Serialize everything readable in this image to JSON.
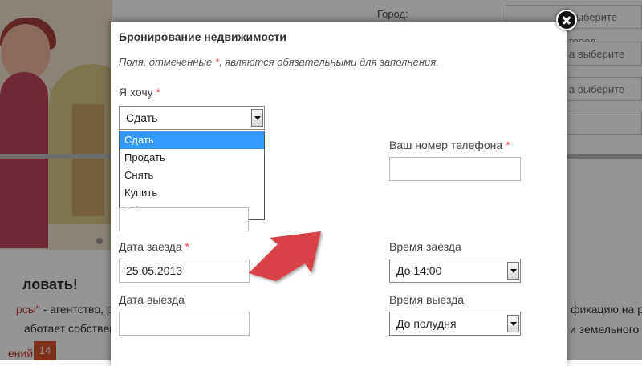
{
  "background": {
    "city_label": "Город:",
    "fields": [
      "Выберите город",
      "а выберите",
      "а выберите",
      ""
    ],
    "welcome": "ловать!",
    "text_line1_highlight": "рсы\"",
    "text_line1_rest": " - агентство, рабо",
    "text_line2": "аботает собственный",
    "reviews_label": "ений",
    "reviews_count": "14",
    "right_text1": "фикацию на ра",
    "right_text2": "и земельного п"
  },
  "modal": {
    "title": "Бронирование недвижимости",
    "note_before": "Поля, отмеченные ",
    "note_star": "*",
    "note_after": ", являются обязательными для заполнения.",
    "required_marker": "*",
    "want": {
      "label": "Я хочу",
      "selected": "Сдать",
      "options": [
        "Сдать",
        "Продать",
        "Снять",
        "Купить",
        "Обменять"
      ]
    },
    "phone": {
      "label": "Ваш номер телефона",
      "value": ""
    },
    "checkin_date": {
      "label": "Дата заезда",
      "value": "25.05.2013"
    },
    "checkin_time": {
      "label": "Время заезда",
      "selected": "До 14:00"
    },
    "checkout_date": {
      "label": "Дата выезда",
      "value": ""
    },
    "checkout_time": {
      "label": "Время выезда",
      "selected": "До полудня"
    }
  },
  "colors": {
    "required": "#e0454b",
    "selected_option_bg": "#3399ff",
    "arrow": "#d9434a",
    "overlay": "rgba(0,0,0,0.42)"
  },
  "icons": [
    "close-icon",
    "chevron-down-icon",
    "arrow-annotation-icon"
  ]
}
